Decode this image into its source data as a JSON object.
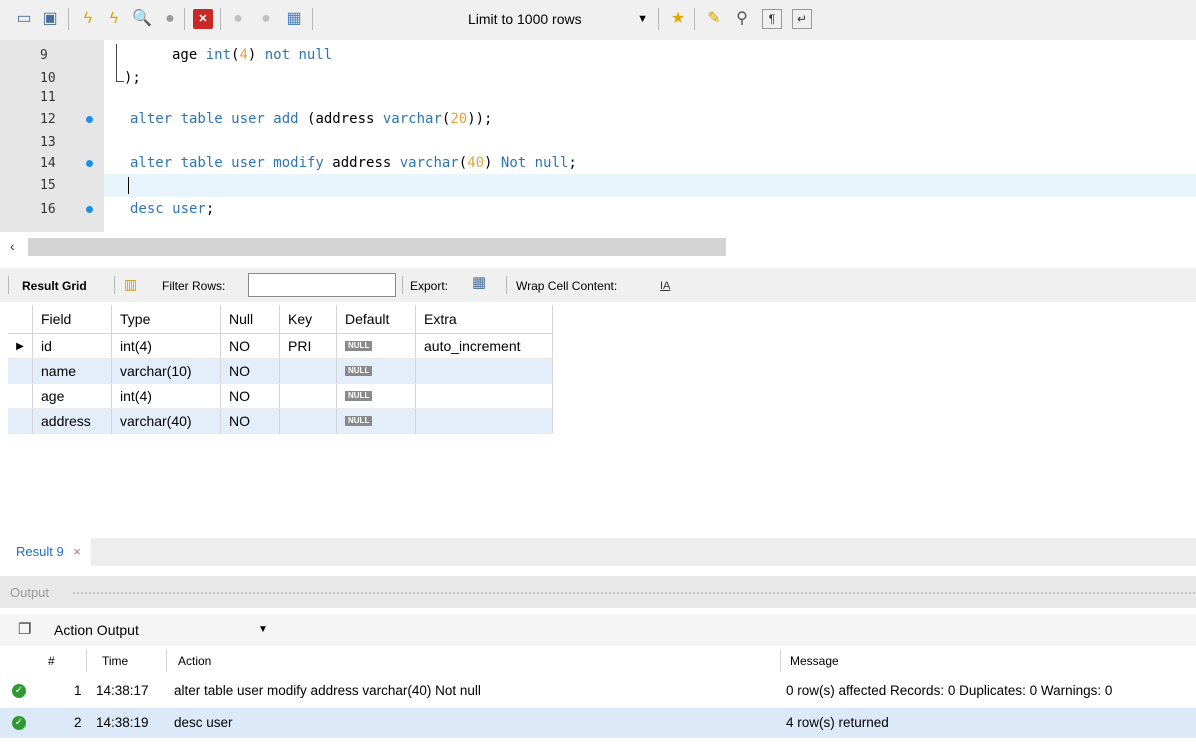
{
  "toolbar": {
    "limit_label": "Limit to 1000 rows",
    "icons": [
      "open-folder-icon",
      "save-icon",
      "execute-icon",
      "execute-current-icon",
      "explain-icon",
      "stop-icon",
      "toggle-error-icon",
      "commit-icon",
      "rollback-icon",
      "autocommit-icon",
      "add-snippet-icon",
      "beautify-icon",
      "find-icon",
      "invisible-chars-icon",
      "wrap-icon"
    ]
  },
  "editor": {
    "lines": [
      {
        "num": "9",
        "marker": false
      },
      {
        "num": "10",
        "marker": false
      },
      {
        "num": "11",
        "marker": false
      },
      {
        "num": "12",
        "marker": true
      },
      {
        "num": "13",
        "marker": false
      },
      {
        "num": "14",
        "marker": true
      },
      {
        "num": "15",
        "marker": false
      },
      {
        "num": "16",
        "marker": true
      }
    ],
    "code": {
      "l9_a": "age ",
      "l9_b": "int",
      "l9_c": "(",
      "l9_d": "4",
      "l9_e": ") ",
      "l9_f": "not null",
      "l10": ");",
      "l12_a": "alter table user add ",
      "l12_b": "(address ",
      "l12_c": "varchar",
      "l12_d": "(",
      "l12_e": "20",
      "l12_f": "));",
      "l14_a": "alter table user modify ",
      "l14_b": "address ",
      "l14_c": "varchar",
      "l14_d": "(",
      "l14_e": "40",
      "l14_f": ") ",
      "l14_g": "Not null",
      "l14_h": ";",
      "l16_a": "desc user",
      "l16_b": ";"
    }
  },
  "result_toolbar": {
    "result_grid": "Result Grid",
    "filter_rows": "Filter Rows:",
    "filter_value": "",
    "export": "Export:",
    "wrap": "Wrap Cell Content:"
  },
  "grid": {
    "columns": [
      "Field",
      "Type",
      "Null",
      "Key",
      "Default",
      "Extra"
    ],
    "null_text": "NULL",
    "rows": [
      [
        "id",
        "int(4)",
        "NO",
        "PRI",
        "NULL",
        "auto_increment"
      ],
      [
        "name",
        "varchar(10)",
        "NO",
        "",
        "NULL",
        ""
      ],
      [
        "age",
        "int(4)",
        "NO",
        "",
        "NULL",
        ""
      ],
      [
        "address",
        "varchar(40)",
        "NO",
        "",
        "NULL",
        ""
      ]
    ]
  },
  "result_tab": {
    "label": "Result 9",
    "close": "×"
  },
  "output": {
    "title": "Output",
    "mode": "Action Output",
    "columns": {
      "num": "#",
      "time": "Time",
      "action": "Action",
      "message": "Message"
    },
    "rows": [
      {
        "num": "1",
        "time": "14:38:17",
        "action": "alter table user modify address varchar(40) Not null",
        "message": "0 row(s) affected Records: 0  Duplicates: 0  Warnings: 0"
      },
      {
        "num": "2",
        "time": "14:38:19",
        "action": "desc user",
        "message": "4 row(s) returned"
      }
    ]
  },
  "colors": {
    "keyword": "#2e75b6",
    "number": "#e8a33d",
    "marker": "#1e8fe6",
    "selection_row": "#dbe9f8",
    "ok": "#2d9a32"
  }
}
